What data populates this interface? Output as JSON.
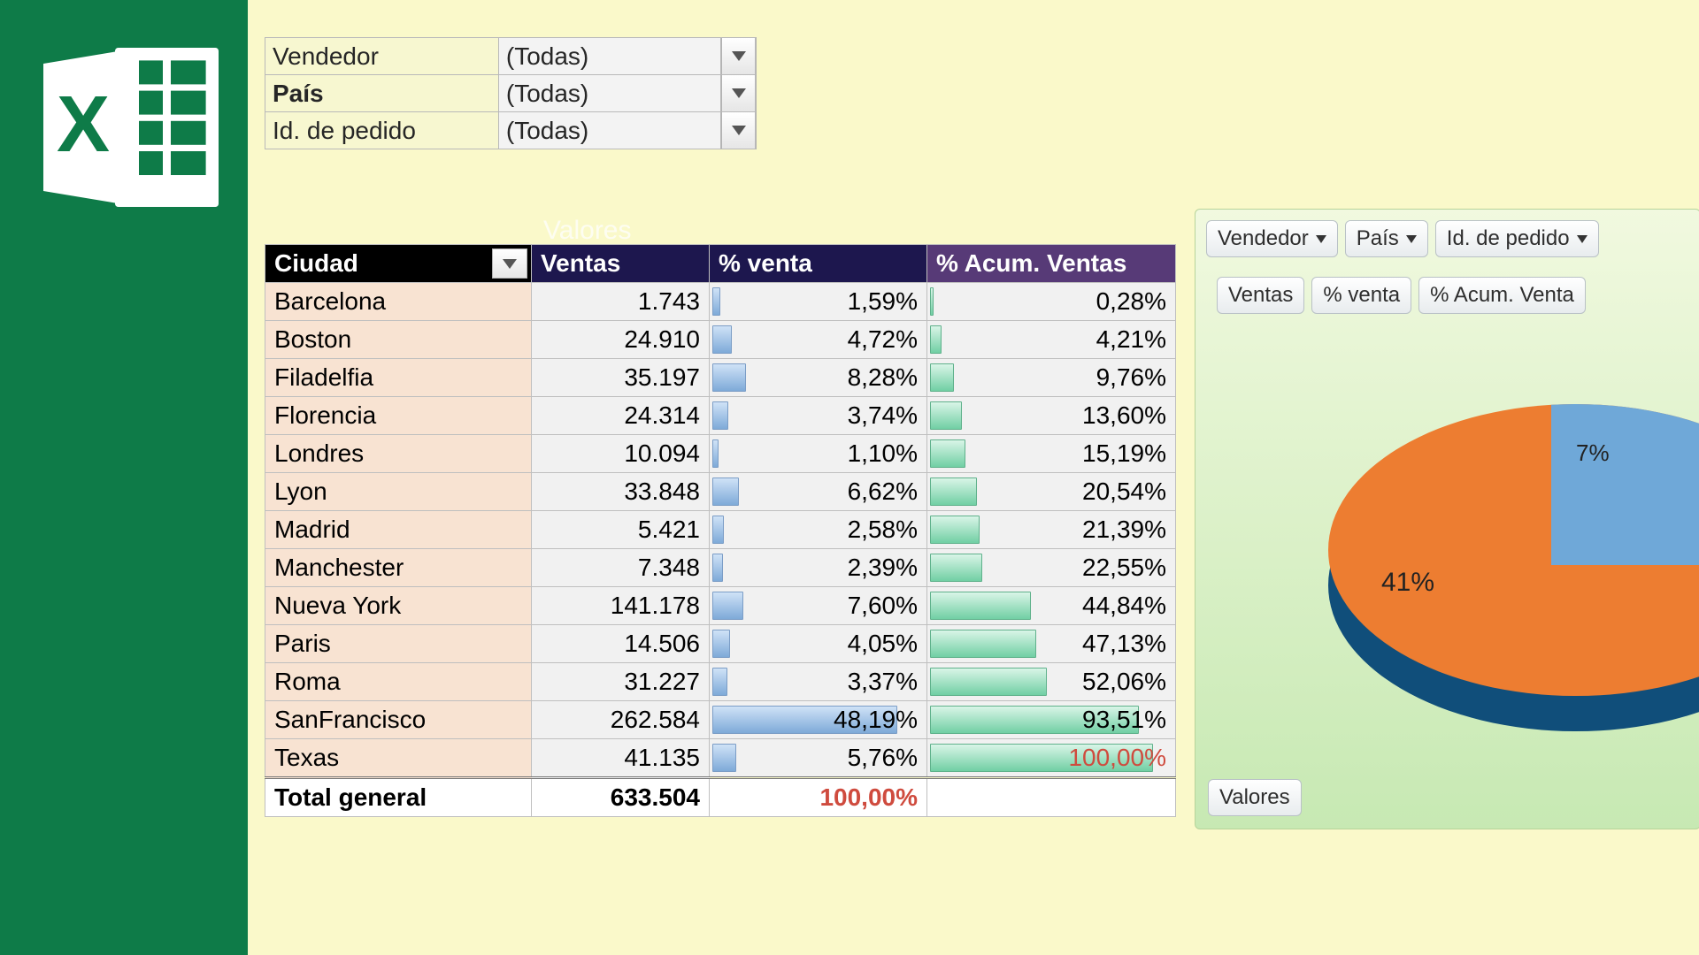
{
  "filters": [
    {
      "label": "Vendedor",
      "value": "(Todas)",
      "bold": false
    },
    {
      "label": "País",
      "value": "(Todas)",
      "bold": true
    },
    {
      "label": "Id. de pedido",
      "value": "(Todas)",
      "bold": false
    }
  ],
  "ghost_label": "Valores",
  "headers": {
    "ciudad": "Ciudad",
    "ventas": "Ventas",
    "pct": "%  venta",
    "acum": "% Acum. Ventas"
  },
  "rows": [
    {
      "city": "Barcelona",
      "ventas": "1.743",
      "pct": "1,59%",
      "pct_w": 0.016,
      "acum": "0,28%",
      "acum_w": 0.003
    },
    {
      "city": "Boston",
      "ventas": "24.910",
      "pct": "4,72%",
      "pct_w": 0.047,
      "acum": "4,21%",
      "acum_w": 0.042
    },
    {
      "city": "Filadelfia",
      "ventas": "35.197",
      "pct": "8,28%",
      "pct_w": 0.083,
      "acum": "9,76%",
      "acum_w": 0.098
    },
    {
      "city": "Florencia",
      "ventas": "24.314",
      "pct": "3,74%",
      "pct_w": 0.037,
      "acum": "13,60%",
      "acum_w": 0.136
    },
    {
      "city": "Londres",
      "ventas": "10.094",
      "pct": "1,10%",
      "pct_w": 0.011,
      "acum": "15,19%",
      "acum_w": 0.152
    },
    {
      "city": "Lyon",
      "ventas": "33.848",
      "pct": "6,62%",
      "pct_w": 0.066,
      "acum": "20,54%",
      "acum_w": 0.205
    },
    {
      "city": "Madrid",
      "ventas": "5.421",
      "pct": "2,58%",
      "pct_w": 0.026,
      "acum": "21,39%",
      "acum_w": 0.214
    },
    {
      "city": "Manchester",
      "ventas": "7.348",
      "pct": "2,39%",
      "pct_w": 0.024,
      "acum": "22,55%",
      "acum_w": 0.226
    },
    {
      "city": "Nueva York",
      "ventas": "141.178",
      "pct": "7,60%",
      "pct_w": 0.076,
      "acum": "44,84%",
      "acum_w": 0.448
    },
    {
      "city": "Paris",
      "ventas": "14.506",
      "pct": "4,05%",
      "pct_w": 0.041,
      "acum": "47,13%",
      "acum_w": 0.471
    },
    {
      "city": "Roma",
      "ventas": "31.227",
      "pct": "3,37%",
      "pct_w": 0.034,
      "acum": "52,06%",
      "acum_w": 0.521
    },
    {
      "city": "SanFrancisco",
      "ventas": "262.584",
      "pct": "48,19%",
      "pct_w": 0.482,
      "acum": "93,51%",
      "acum_w": 0.935
    },
    {
      "city": "Texas",
      "ventas": "41.135",
      "pct": "5,76%",
      "pct_w": 0.058,
      "acum": "100,00%",
      "acum_w": 1.0,
      "acum_red": true
    }
  ],
  "totals": {
    "label": "Total general",
    "ventas": "633.504",
    "pct": "100,00%",
    "acum": ""
  },
  "chart_panel": {
    "top_chips": [
      "Vendedor",
      "País",
      "Id. de pedido"
    ],
    "value_chips": [
      "Ventas",
      "%  venta",
      "% Acum. Venta"
    ],
    "bottom_chip": "Valores",
    "visible_labels": {
      "top": "7%",
      "side": "41%"
    }
  },
  "chart_data": {
    "type": "pie",
    "title": "",
    "note": "3D pie chart, partially cropped on the right edge of the screenshot.",
    "visible_slices": [
      {
        "label": "7%",
        "value": 7,
        "color": "#6fa8d8"
      },
      {
        "label": "41%",
        "value": 41,
        "color": "#ed7d31"
      }
    ]
  }
}
